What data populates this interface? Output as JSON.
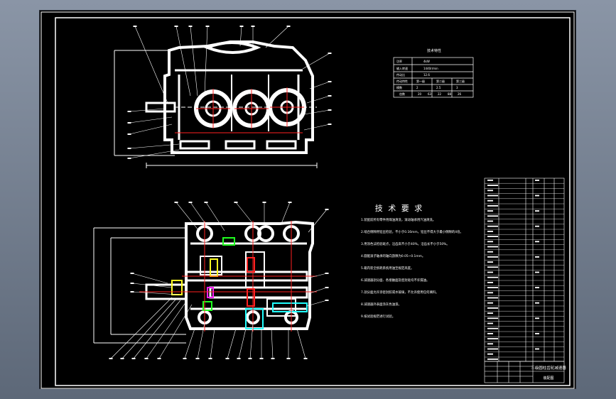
{
  "drawing": {
    "tech_requirements": {
      "title": "技 术 要 求",
      "lines": [
        "1.装配前所有零件用煤油清洗，滚动轴承用汽油清洗。",
        "2.啮合侧隙用铅丝检验，不小于0.16mm，铅丝不得大于最小侧隙的4倍。",
        "3.用涂色法检验斑点，沿齿高不小于40%，沿齿长不小于50%。",
        "4.圆锥滚子轴承的轴向游隙为0.05~0.1mm。",
        "5.箱内装全损耗系统用油至规定高度。",
        "6.减速器剖分面、各接触面及密封处均不许漏油。",
        "7.剖分面允许涂密封胶或水玻璃，不允许使用任何填料。",
        "8.减速器外表面涂灰色油漆。",
        "9.按试验规范进行试验。"
      ]
    },
    "spec_table": {
      "title": "技术特性",
      "rows": [
        [
          "功率",
          "4kW"
        ],
        [
          "输入转速",
          "1440r/min"
        ],
        [
          "传动比",
          "12.6"
        ],
        [
          "传动特性",
          "第一级",
          "第二级",
          "第三级"
        ],
        [
          "模数",
          "2",
          "2.5",
          "3"
        ],
        [
          "齿数",
          "20",
          "63",
          "22",
          "88",
          "26"
        ]
      ]
    },
    "title_block": {
      "name": "三级圆柱齿轮减速器",
      "drawing_no": "装配图"
    }
  }
}
